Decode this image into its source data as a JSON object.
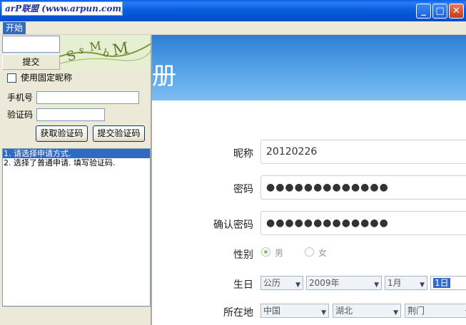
{
  "window": {
    "logo_text": "arP联盟 (www.arpun.com)",
    "minimize": "_",
    "maximize": "□",
    "close": "✕"
  },
  "menu": {
    "start": "开始"
  },
  "left_panel": {
    "submit_label": "提交",
    "captcha_text": "SsMbM",
    "fixed_nickname_label": "使用固定昵称",
    "phone_label": "手机号",
    "code_label": "验证码",
    "phone_value": "",
    "code_value": "",
    "get_code_button": "获取验证码",
    "submit_code_button": "提交验证码",
    "log": [
      "1. 请选择申请方式.",
      "2. 选择了普通申请. 填写验证码."
    ]
  },
  "web_form": {
    "banner_title": "册",
    "nickname_label": "昵称",
    "nickname_value": "20120226",
    "password_label": "密码",
    "password_value": "●●●●●●●●●●●●●",
    "confirm_label": "确认密码",
    "confirm_value": "●●●●●●●●●●●●●",
    "gender_label": "性别",
    "gender_male": "男",
    "gender_female": "女",
    "birthday_label": "生日",
    "calendar": "公历",
    "year": "2009年",
    "month": "1月",
    "day": "1日",
    "location_label": "所在地",
    "country": "中国",
    "province": "湖北",
    "city": "荆门"
  },
  "colors": {
    "titlebar": "#0a5fe8",
    "selection": "#316ac5",
    "banner": "#4a98e4",
    "radio_checked": "#8cc44a"
  }
}
